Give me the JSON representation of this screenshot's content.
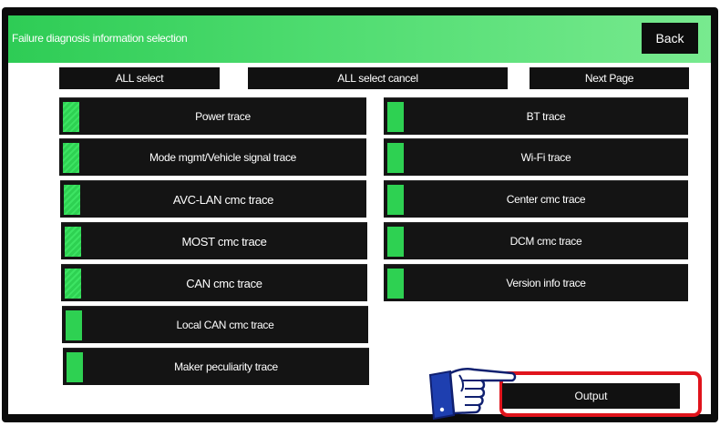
{
  "header": {
    "title": "Failure diagnosis information selection",
    "back_label": "Back"
  },
  "toolbar": {
    "all_select": "ALL select",
    "all_select_cancel": "ALL select cancel",
    "next_page": "Next Page"
  },
  "left_items": [
    {
      "label": "Power trace",
      "checked": true
    },
    {
      "label": "Mode mgmt/Vehicle signal trace",
      "checked": true
    },
    {
      "label": "AVC-LAN cmc trace",
      "checked": true
    },
    {
      "label": "MOST cmc trace",
      "checked": true
    },
    {
      "label": "CAN cmc trace",
      "checked": true
    },
    {
      "label": "Local CAN cmc trace",
      "checked": true
    },
    {
      "label": "Maker peculiarity trace",
      "checked": true
    }
  ],
  "right_items": [
    {
      "label": "BT trace",
      "checked": true
    },
    {
      "label": "Wi-Fi trace",
      "checked": true
    },
    {
      "label": "Center cmc trace",
      "checked": true
    },
    {
      "label": "DCM cmc trace",
      "checked": true
    },
    {
      "label": "Version info trace",
      "checked": true
    }
  ],
  "output_label": "Output",
  "colors": {
    "header_green": "#2ecc55",
    "check_green": "#2ed152",
    "highlight_red": "#e0141c",
    "button_black": "#111111"
  },
  "icons": {
    "pointer": "pointing-hand-icon"
  }
}
